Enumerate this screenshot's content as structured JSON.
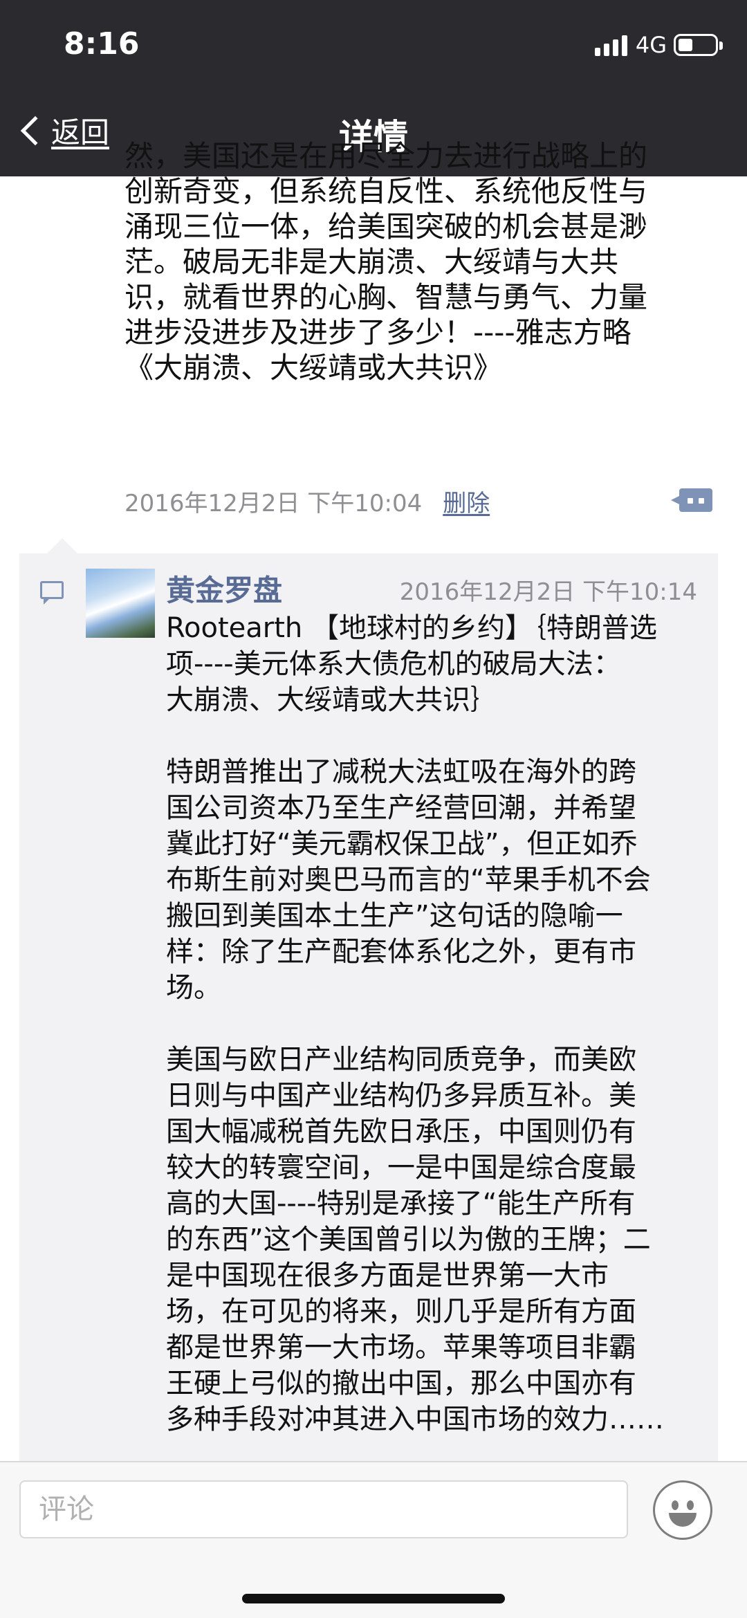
{
  "status_bar": {
    "time": "8:16",
    "network": "4G"
  },
  "nav": {
    "back_label": "返回",
    "title": "详情"
  },
  "post": {
    "lines": [
      "然，美国还是在用尽全力去进行战略上的",
      "创新奇变，但系统自反性、系统他反性与",
      "涌现三位一体，给美国突破的机会甚是渺",
      "茫。破局无非是大崩溃、大绥靖与大共",
      "识，就看世界的心胸、智慧与勇气、力量",
      "进步没进步及进步了多少！----雅志方略",
      "《大崩溃、大绥靖或大共识》"
    ],
    "timestamp": "2016年12月2日 下午10:04",
    "delete_label": "删除"
  },
  "comment": {
    "author": "黄金罗盘",
    "time": "2016年12月2日 下午10:14",
    "paragraph1": [
      "Rootearth 【地球村的乡约】｛特朗普选",
      "项----美元体系大债危机的破局大法：",
      "大崩溃、大绥靖或大共识｝"
    ],
    "paragraph2": [
      "特朗普推出了减税大法虹吸在海外的跨",
      "国公司资本乃至生产经营回潮，并希望",
      "冀此打好“美元霸权保卫战”，但正如乔",
      "布斯生前对奥巴马而言的“苹果手机不会",
      "搬回到美国本土生产”这句话的隐喻一",
      "样：除了生产配套体系化之外，更有市",
      "场。"
    ],
    "paragraph3": [
      "美国与欧日产业结构同质竞争，而美欧",
      "日则与中国产业结构仍多异质互补。美",
      "国大幅减税首先欧日承压，中国则仍有",
      "较大的转寰空间，一是中国是综合度最",
      "高的大国----特别是承接了“能生产所有",
      "的东西”这个美国曾引以为傲的王牌；二",
      "是中国现在很多方面是世界第一大市",
      "场，在可见的将来，则几乎是所有方面",
      "都是世界第一大市场。苹果等项目非霸",
      "王硬上弓似的撤出中国，那么中国亦有",
      "多种手段对冲其进入中国市场的效力……"
    ]
  },
  "input": {
    "placeholder": "评论"
  },
  "icons": {
    "back": "chevron-left-icon",
    "comment_toggle": "more-dots-icon",
    "comment": "comment-bubble-icon",
    "emoji": "smiley-face-icon"
  },
  "colors": {
    "header_bg": "#2b2b2f",
    "link": "#576b95",
    "panel_bg": "#f2f2f5",
    "meta_gray": "#8e8e93"
  }
}
